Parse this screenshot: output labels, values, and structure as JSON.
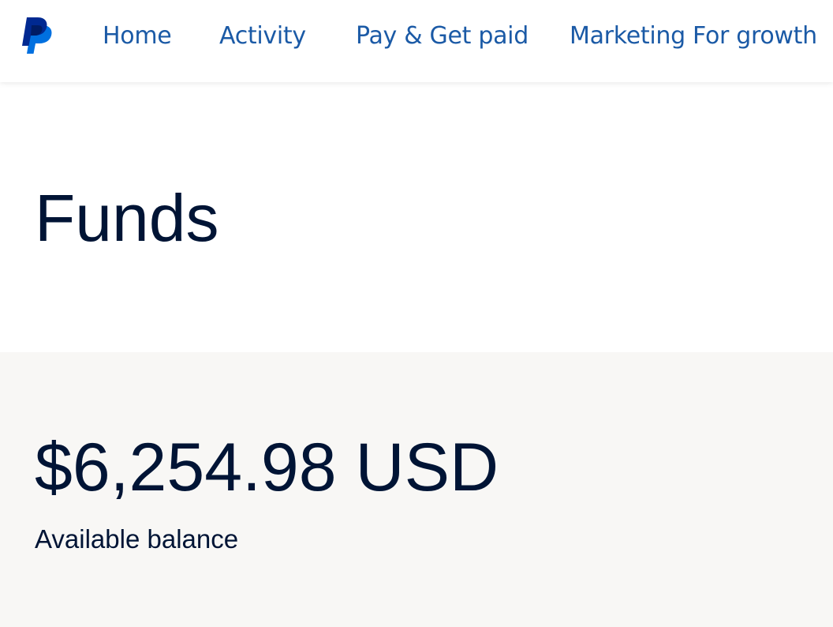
{
  "header": {
    "logo_icon": "paypal-logo-icon",
    "nav": [
      {
        "label": "Home"
      },
      {
        "label": "Activity"
      },
      {
        "label": "Pay & Get paid"
      },
      {
        "label": "Marketing For growth"
      }
    ]
  },
  "page": {
    "title": "Funds"
  },
  "balance": {
    "amount": "$6,254.98 USD",
    "label": "Available balance"
  },
  "colors": {
    "nav_text": "#1b5aa6",
    "heading_text": "#001435",
    "balance_bg": "#f8f7f5",
    "logo_dark": "#002991",
    "logo_light": "#0070e0"
  }
}
